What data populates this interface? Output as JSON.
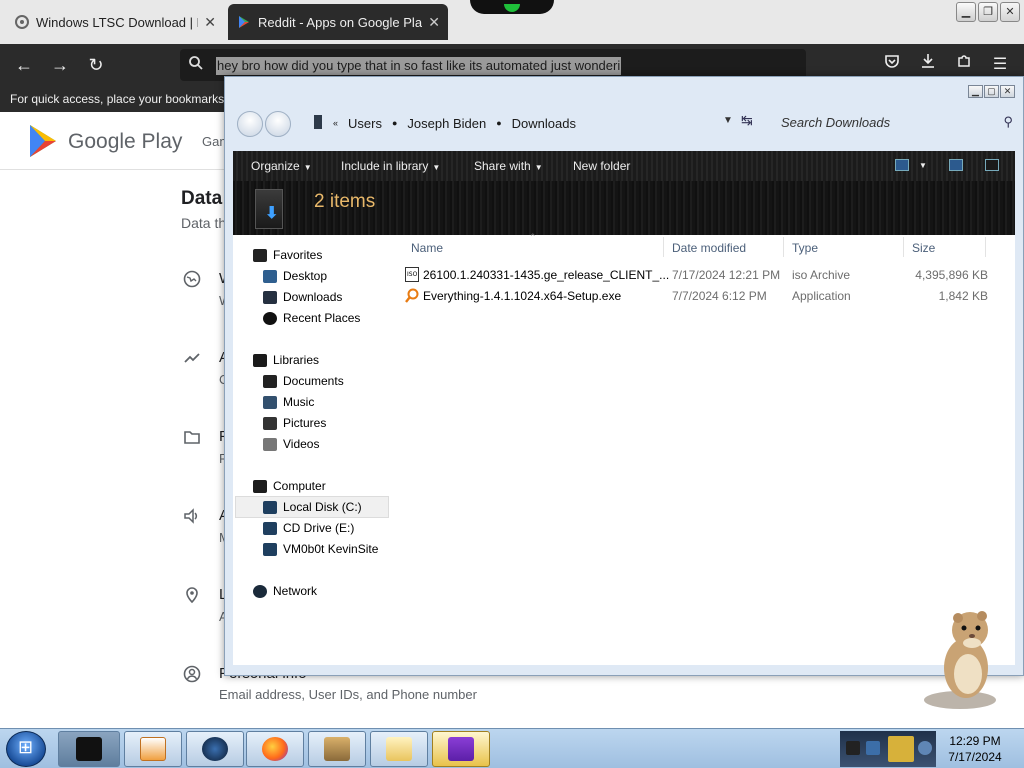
{
  "browser": {
    "tabs": [
      {
        "title": "Windows LTSC Download | MAS",
        "active": false
      },
      {
        "title": "Reddit - Apps on Google Play",
        "active": true
      }
    ],
    "address_text": "hey bro how did you type that in so fast like its automated just wonderi",
    "bookmarks_hint": "For quick access, place your bookmarks h"
  },
  "page": {
    "brand": "Google Play",
    "nav_first": "Gam",
    "section_title": "Data",
    "section_sub": "Data th",
    "rows": [
      {
        "title": "W",
        "sub": "W",
        "icon": "globe-icon"
      },
      {
        "title": "A",
        "sub": "C",
        "icon": "trend-icon"
      },
      {
        "title": "F",
        "sub": "F",
        "icon": "folder-icon"
      },
      {
        "title": "A",
        "sub": "M",
        "icon": "speaker-icon"
      },
      {
        "title": "L",
        "sub": "A",
        "icon": "location-icon"
      }
    ],
    "personal_title": "Personal info",
    "personal_sub": "Email address, User IDs, and Phone number"
  },
  "explorer": {
    "breadcrumb": [
      "Users",
      "Joseph Biden",
      "Downloads"
    ],
    "search_placeholder": "Search Downloads",
    "toolbar": {
      "organize": "Organize",
      "include": "Include in library",
      "share": "Share with",
      "new_folder": "New folder"
    },
    "item_count": "2 items",
    "nav": {
      "favorites": "Favorites",
      "desktop": "Desktop",
      "downloads": "Downloads",
      "recent": "Recent Places",
      "libraries": "Libraries",
      "documents": "Documents",
      "music": "Music",
      "pictures": "Pictures",
      "videos": "Videos",
      "computer": "Computer",
      "local_disk": "Local Disk (C:)",
      "cd_drive": "CD Drive (E:)",
      "vmshare": "VM0b0t KevinSite",
      "network": "Network"
    },
    "columns": {
      "name": "Name",
      "date": "Date modified",
      "type": "Type",
      "size": "Size"
    },
    "files": [
      {
        "name": "26100.1.240331-1435.ge_release_CLIENT_...",
        "date": "7/17/2024 12:21 PM",
        "type": "iso Archive",
        "size": "4,395,896 KB",
        "icon": "iso-file-icon"
      },
      {
        "name": "Everything-1.4.1.1024.x64-Setup.exe",
        "date": "7/7/2024 6:12 PM",
        "type": "Application",
        "size": "1,842 KB",
        "icon": "everything-app-icon"
      }
    ]
  },
  "taskbar": {
    "time": "12:29 PM",
    "date": "7/17/2024"
  },
  "colors": {
    "browser_dark": "#2b2b2b",
    "explorer_frame": "#dfe9f5",
    "banner_text": "#e8b86a",
    "column_header": "#4c607a",
    "taskbar": "#bcd6ef"
  }
}
